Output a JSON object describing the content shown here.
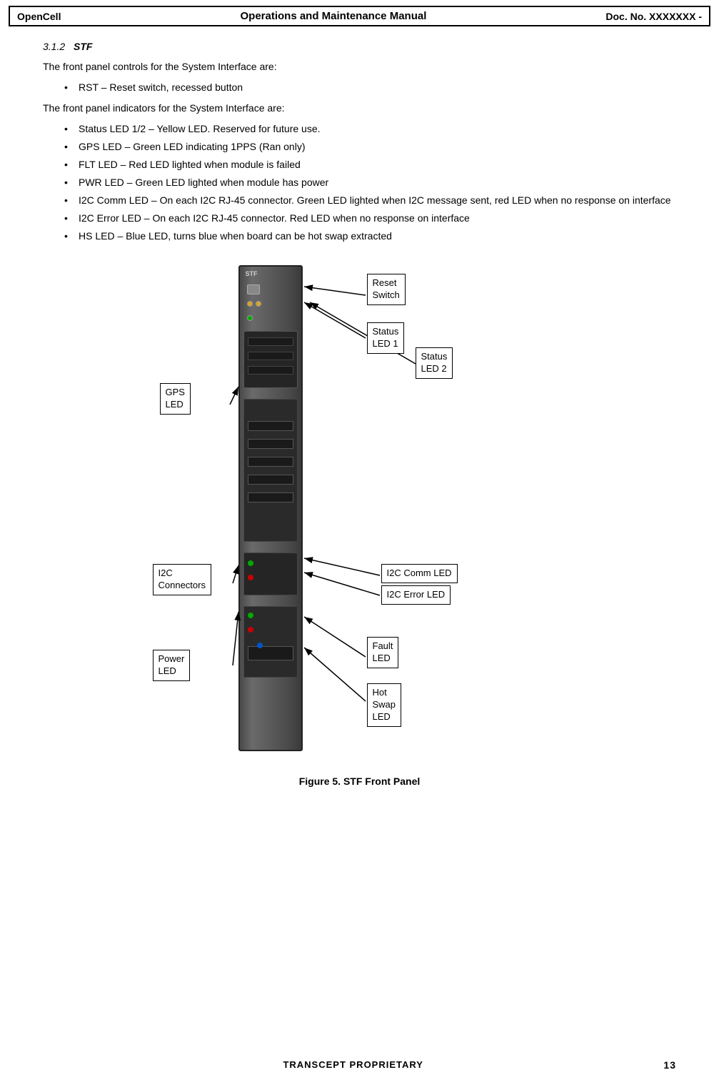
{
  "header": {
    "left": "OpenCell",
    "center": "Operations and Maintenance Manual",
    "right": "Doc. No.  XXXXXXX -"
  },
  "section": {
    "number": "3.1.2",
    "title": "STF"
  },
  "paragraphs": {
    "controls_intro": "The front panel controls for the System Interface are:",
    "indicators_intro": "The front panel indicators for the System Interface are:"
  },
  "controls_bullets": [
    "RST – Reset switch, recessed button"
  ],
  "indicators_bullets": [
    "Status LED 1/2 – Yellow LED.  Reserved for future use.",
    "GPS LED – Green LED indicating 1PPS (Ran only)",
    "FLT LED – Red LED lighted when module is failed",
    "PWR LED – Green LED lighted when module has power",
    "I2C Comm LED – On each I2C RJ-45 connector.  Green LED lighted when I2C message sent, red LED when no response on interface",
    "I2C Error LED – On each I2C RJ-45 connector.  Red LED when no response on interface",
    "HS LED – Blue LED, turns blue when board can be hot swap extracted"
  ],
  "callouts": {
    "reset_switch": "Reset\nSwitch",
    "status_led1": "Status\nLED 1",
    "status_led2": "Status\nLED 2",
    "gps_led": "GPS\nLED",
    "i2c_connectors": "I2C\nConnectors",
    "i2c_comm_led": "I2C Comm LED",
    "i2c_error_led": "I2C Error LED",
    "power_led": "Power\nLED",
    "fault_led": "Fault\nLED",
    "hot_swap_led": "Hot\nSwap\nLED"
  },
  "figure_caption": "Figure 5.  STF Front Panel",
  "footer": {
    "proprietary": "TRANSCEPT PROPRIETARY",
    "page_number": "13"
  }
}
